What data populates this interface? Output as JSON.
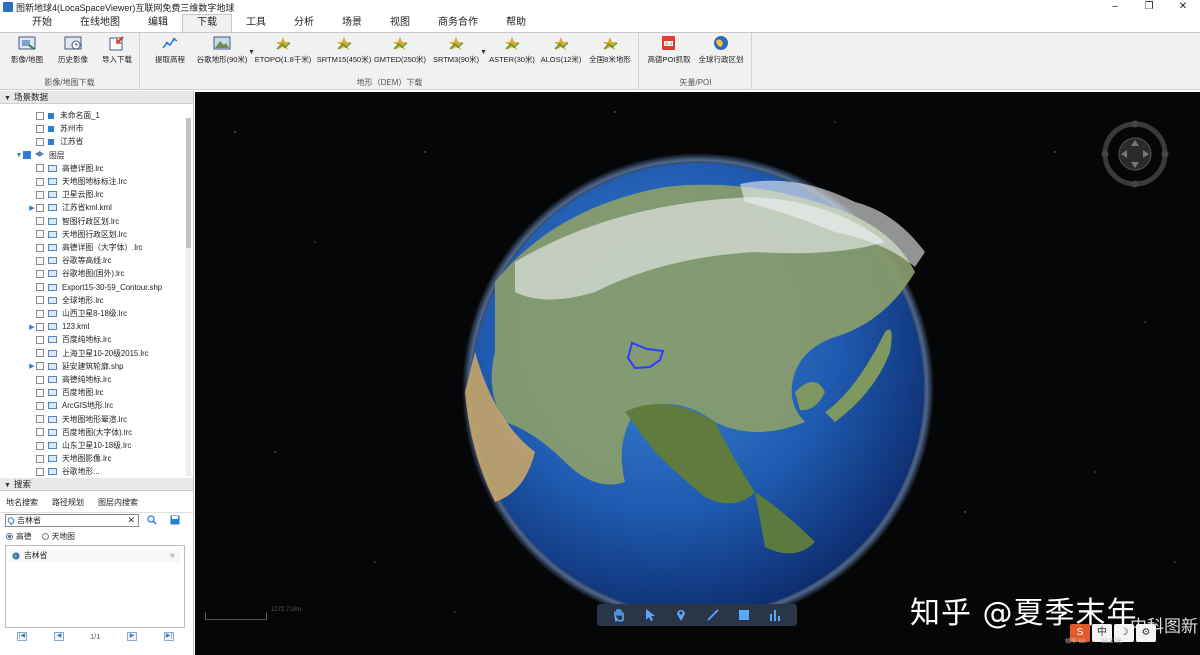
{
  "window": {
    "title": "图新地球4(LocaSpaceViewer)互联网免费三维数字地球",
    "minimize": "–",
    "maximize": "❐",
    "close": "✕"
  },
  "menu": [
    "开始",
    "在线地图",
    "编辑",
    "下载",
    "工具",
    "分析",
    "场景",
    "视图",
    "商务合作",
    "帮助"
  ],
  "menu_active": "下载",
  "ribbon": {
    "group1": {
      "label": "影像/地图下载",
      "buttons": [
        "影像/地图",
        "历史影像",
        "导入下载"
      ]
    },
    "group2": {
      "label": "地形（DEM）下载",
      "buttons": [
        "提取高程",
        "谷歌地形(90米)",
        "ETOPO(1.8千米)",
        "SRTM15(450米)",
        "GMTED(250米)",
        "SRTM3(90米)",
        "ASTER(30米)",
        "ALOS(12米)",
        "全国8米地形"
      ]
    },
    "group3": {
      "label": "矢量/POI",
      "buttons": [
        "高德POI抓取",
        "全球行政区划"
      ]
    },
    "dropdown_glyph": "▼"
  },
  "scene_panel": {
    "title": "场景数据",
    "tree": [
      {
        "label": "未命名面_1",
        "indent": 3,
        "icon": "square",
        "checked": false,
        "expander": ""
      },
      {
        "label": "苏州市",
        "indent": 3,
        "icon": "square",
        "checked": false,
        "expander": ""
      },
      {
        "label": "江苏省",
        "indent": 3,
        "icon": "square",
        "checked": false,
        "expander": ""
      },
      {
        "label": "图层",
        "indent": 2,
        "icon": "layers",
        "checked": true,
        "expander": "▼"
      },
      {
        "label": "高德详图.lrc",
        "indent": 3,
        "icon": "monitor",
        "checked": false,
        "expander": ""
      },
      {
        "label": "天地图地标标注.lrc",
        "indent": 3,
        "icon": "monitor",
        "checked": false,
        "expander": ""
      },
      {
        "label": "卫星云图.lrc",
        "indent": 3,
        "icon": "monitor",
        "checked": false,
        "expander": ""
      },
      {
        "label": "江苏省kml.kml",
        "indent": 3,
        "icon": "monitor",
        "checked": false,
        "expander": "▶"
      },
      {
        "label": "智图行政区划.lrc",
        "indent": 3,
        "icon": "monitor",
        "checked": false,
        "expander": ""
      },
      {
        "label": "天地图行政区划.lrc",
        "indent": 3,
        "icon": "monitor",
        "checked": false,
        "expander": ""
      },
      {
        "label": "高德详图（大字体）.lrc",
        "indent": 3,
        "icon": "monitor",
        "checked": false,
        "expander": ""
      },
      {
        "label": "谷歌等高线.lrc",
        "indent": 3,
        "icon": "monitor",
        "checked": false,
        "expander": ""
      },
      {
        "label": "谷歌地图(国外).lrc",
        "indent": 3,
        "icon": "monitor",
        "checked": false,
        "expander": ""
      },
      {
        "label": "Export15-30-59_Contour.shp",
        "indent": 3,
        "icon": "monitor",
        "checked": false,
        "expander": ""
      },
      {
        "label": "全球地形.lrc",
        "indent": 3,
        "icon": "monitor",
        "checked": false,
        "expander": ""
      },
      {
        "label": "山西卫星8-18级.lrc",
        "indent": 3,
        "icon": "monitor",
        "checked": false,
        "expander": ""
      },
      {
        "label": "123.kml",
        "indent": 3,
        "icon": "monitor",
        "checked": false,
        "expander": "▶"
      },
      {
        "label": "百度纯地标.lrc",
        "indent": 3,
        "icon": "monitor",
        "checked": false,
        "expander": ""
      },
      {
        "label": "上海卫星10-20级2015.lrc",
        "indent": 3,
        "icon": "monitor",
        "checked": false,
        "expander": ""
      },
      {
        "label": "延安建筑轮廓.shp",
        "indent": 3,
        "icon": "monitor",
        "checked": false,
        "expander": "▶"
      },
      {
        "label": "高德纯地标.lrc",
        "indent": 3,
        "icon": "monitor",
        "checked": false,
        "expander": ""
      },
      {
        "label": "百度地图.lrc",
        "indent": 3,
        "icon": "monitor",
        "checked": false,
        "expander": ""
      },
      {
        "label": "ArcGIS地形.lrc",
        "indent": 3,
        "icon": "monitor",
        "checked": false,
        "expander": ""
      },
      {
        "label": "天地图地形晕渲.lrc",
        "indent": 3,
        "icon": "monitor",
        "checked": false,
        "expander": ""
      },
      {
        "label": "百度地图(大字体).lrc",
        "indent": 3,
        "icon": "monitor",
        "checked": false,
        "expander": ""
      },
      {
        "label": "山东卫星10-18级.lrc",
        "indent": 3,
        "icon": "monitor",
        "checked": false,
        "expander": ""
      },
      {
        "label": "天地图影像.lrc",
        "indent": 3,
        "icon": "monitor",
        "checked": false,
        "expander": ""
      },
      {
        "label": "谷歌地形...",
        "indent": 3,
        "icon": "monitor",
        "checked": false,
        "expander": ""
      }
    ]
  },
  "search_panel": {
    "title": "搜索",
    "tabs": [
      "地名搜索",
      "路径规划",
      "图层内搜索"
    ],
    "query": "吉林省",
    "clear": "✕",
    "radio_options": [
      "高德",
      "天地图"
    ],
    "radio_selected": "高德",
    "results": [
      "吉林省"
    ],
    "page": "1/1",
    "pager": [
      "|◀",
      "◀",
      "▶",
      "▶|"
    ]
  },
  "viewer": {
    "scale_text": "1272.718m",
    "watermark": "知乎 @夏季末年",
    "watermark2": "中科图新",
    "status": [
      "帧率 69.",
      "08.87米"
    ],
    "ime": [
      "S",
      "中",
      "☽",
      "⚙"
    ],
    "star": "★"
  }
}
